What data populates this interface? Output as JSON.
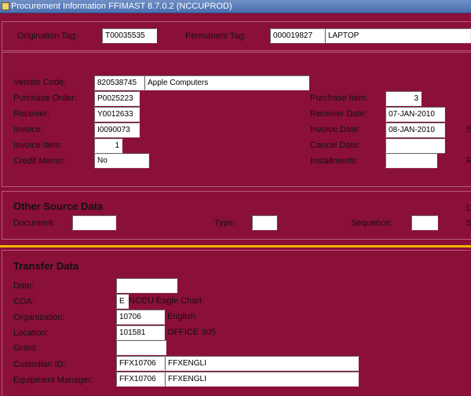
{
  "window": {
    "title": "Procurement Information  FFIMAST  8.7.0.2  (NCCUPROD)"
  },
  "header": {
    "origination_tag_label": "Origination Tag:",
    "origination_tag_value": "T00035535",
    "permanent_tag_label": "Permanent Tag:",
    "permanent_tag_value": "000019827",
    "permanent_tag_desc": "LAPTOP"
  },
  "procurement": {
    "vendor_code_label": "Vendor Code:",
    "vendor_code_value": "820538745",
    "vendor_name": "Apple Computers",
    "purchase_order_label": "Purchase Order:",
    "purchase_order_value": "P0025223",
    "receiver_label": "Receiver:",
    "receiver_value": "Y0012633",
    "invoice_label": "Invoice:",
    "invoice_value": "I0090073",
    "invoice_item_label": "Invoice Item:",
    "invoice_item_value": "1",
    "credit_memo_label": "Credit Memo:",
    "credit_memo_value": "No",
    "purchase_item_label": "Purchase Item:",
    "purchase_item_value": "3",
    "receiver_date_label": "Receiver Date:",
    "receiver_date_value": "07-JAN-2010",
    "invoice_date_label": "Invoice Date:",
    "invoice_date_value": "08-JAN-2010",
    "cancel_date_label": "Cancel Date:",
    "cancel_date_value": "",
    "installments_label": "Installments:",
    "installments_value": "",
    "edge_s": "S",
    "edge_r": "R"
  },
  "other_source": {
    "title": "Other Source Data",
    "document_label": "Document:",
    "document_value": "",
    "type_label": "Type:",
    "type_value": "",
    "sequence_label": "Sequence:",
    "sequence_value": "",
    "edge_d": "D",
    "edge_s": "S"
  },
  "transfer": {
    "title": "Transfer Data",
    "date_label": "Date:",
    "date_value": "",
    "coa_label": "COA:",
    "coa_value": "E",
    "coa_desc": "NCCU Eagle Chart",
    "organization_label": "Organization:",
    "organization_value": "10706",
    "organization_desc": "English",
    "location_label": "Location:",
    "location_value": "101581",
    "location_desc": "OFFICE 305",
    "grant_label": "Grant:",
    "grant_value": "",
    "custodian_label": "Custodian ID:",
    "custodian_value": "FFX10706",
    "custodian_name": "FFXENGLI",
    "equipment_manager_label": "Equipment Manager:",
    "equipment_manager_value": "FFX10706",
    "equipment_manager_name": "FFXENGLI"
  },
  "colors": {
    "background": "#8a1038",
    "titlebar": "#4a6fb0",
    "separator": "#f0b400"
  }
}
